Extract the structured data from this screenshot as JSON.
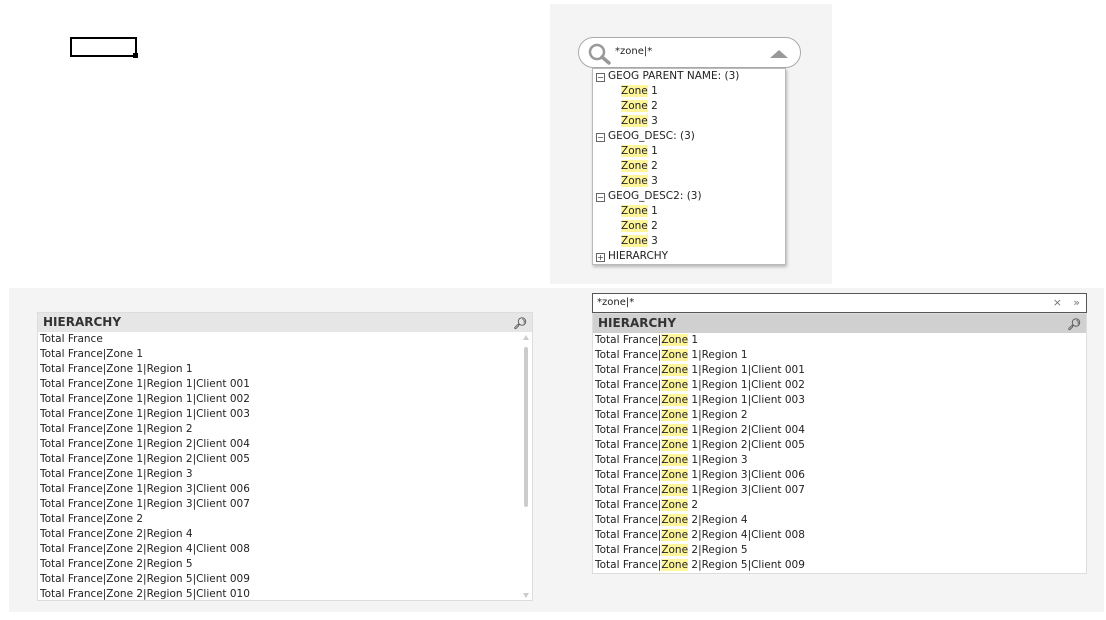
{
  "search_dropdown": {
    "query": "*zone|*",
    "groups": [
      {
        "label": "GEOG PARENT NAME: (3)",
        "expanded": true,
        "items": [
          {
            "hit": "Zone",
            "post": " 1"
          },
          {
            "hit": "Zone",
            "post": " 2"
          },
          {
            "hit": "Zone",
            "post": " 3"
          }
        ]
      },
      {
        "label": "GEOG_DESC: (3)",
        "expanded": true,
        "items": [
          {
            "hit": "Zone",
            "post": " 1"
          },
          {
            "hit": "Zone",
            "post": " 2"
          },
          {
            "hit": "Zone",
            "post": " 3"
          }
        ]
      },
      {
        "label": "GEOG_DESC2: (3)",
        "expanded": true,
        "items": [
          {
            "hit": "Zone",
            "post": " 1"
          },
          {
            "hit": "Zone",
            "post": " 2"
          },
          {
            "hit": "Zone",
            "post": " 3"
          }
        ]
      },
      {
        "label": "HIERARCHY",
        "expanded": false,
        "items": []
      }
    ]
  },
  "left_listbox": {
    "title": "HIERARCHY",
    "rows": [
      "Total France",
      "Total France|Zone 1",
      "Total France|Zone 1|Region 1",
      "Total France|Zone 1|Region 1|Client 001",
      "Total France|Zone 1|Region 1|Client 002",
      "Total France|Zone 1|Region 1|Client 003",
      "Total France|Zone 1|Region 2",
      "Total France|Zone 1|Region 2|Client 004",
      "Total France|Zone 1|Region 2|Client 005",
      "Total France|Zone 1|Region 3",
      "Total France|Zone 1|Region 3|Client 006",
      "Total France|Zone 1|Region 3|Client 007",
      "Total France|Zone 2",
      "Total France|Zone 2|Region 4",
      "Total France|Zone 2|Region 4|Client 008",
      "Total France|Zone 2|Region 5",
      "Total France|Zone 2|Region 5|Client 009",
      "Total France|Zone 2|Region 5|Client 010"
    ]
  },
  "right_listbox": {
    "search_value": "*zone|*",
    "clear_icon": "×",
    "more_icon": "»",
    "title": "HIERARCHY",
    "rows": [
      {
        "pre": "Total France|",
        "hit": "Zone",
        "post": " 1"
      },
      {
        "pre": "Total France|",
        "hit": "Zone",
        "post": " 1|Region 1"
      },
      {
        "pre": "Total France|",
        "hit": "Zone",
        "post": " 1|Region 1|Client 001"
      },
      {
        "pre": "Total France|",
        "hit": "Zone",
        "post": " 1|Region 1|Client 002"
      },
      {
        "pre": "Total France|",
        "hit": "Zone",
        "post": " 1|Region 1|Client 003"
      },
      {
        "pre": "Total France|",
        "hit": "Zone",
        "post": " 1|Region 2"
      },
      {
        "pre": "Total France|",
        "hit": "Zone",
        "post": " 1|Region 2|Client 004"
      },
      {
        "pre": "Total France|",
        "hit": "Zone",
        "post": " 1|Region 2|Client 005"
      },
      {
        "pre": "Total France|",
        "hit": "Zone",
        "post": " 1|Region 3"
      },
      {
        "pre": "Total France|",
        "hit": "Zone",
        "post": " 1|Region 3|Client 006"
      },
      {
        "pre": "Total France|",
        "hit": "Zone",
        "post": " 1|Region 3|Client 007"
      },
      {
        "pre": "Total France|",
        "hit": "Zone",
        "post": " 2"
      },
      {
        "pre": "Total France|",
        "hit": "Zone",
        "post": " 2|Region 4"
      },
      {
        "pre": "Total France|",
        "hit": "Zone",
        "post": " 2|Region 4|Client 008"
      },
      {
        "pre": "Total France|",
        "hit": "Zone",
        "post": " 2|Region 5"
      },
      {
        "pre": "Total France|",
        "hit": "Zone",
        "post": " 2|Region 5|Client 009"
      }
    ]
  },
  "colors": {
    "highlight": "#fff59a",
    "header_left": "#e6e6e6",
    "header_right": "#d0d0d0"
  }
}
